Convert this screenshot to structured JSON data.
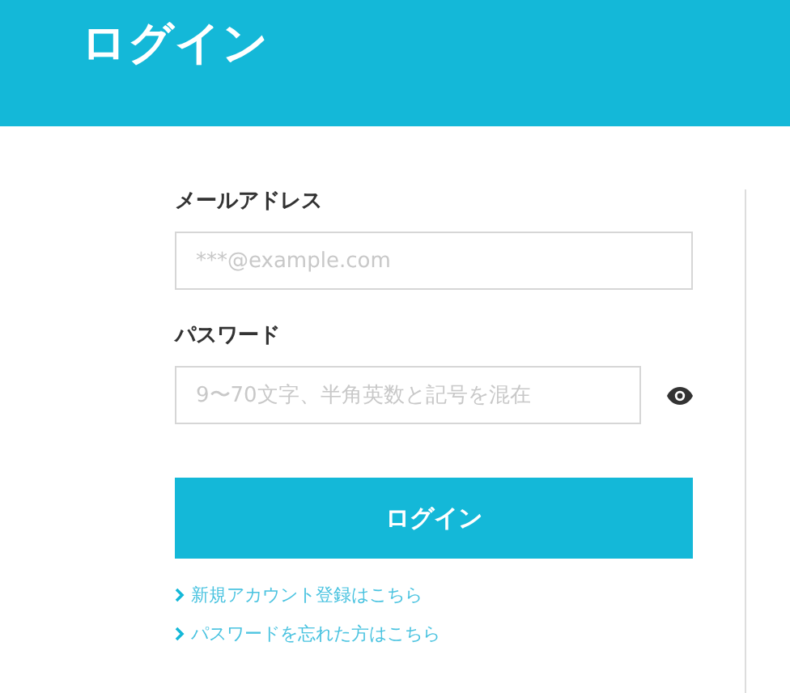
{
  "header": {
    "title": "ログイン"
  },
  "email": {
    "label": "メールアドレス",
    "placeholder": "***@example.com"
  },
  "password": {
    "label": "パスワード",
    "placeholder": "9〜70文字、半角英数と記号を混在"
  },
  "submit": {
    "label": "ログイン"
  },
  "links": [
    {
      "label": "新規アカウント登録はこちら"
    },
    {
      "label": "パスワードを忘れた方はこちら"
    }
  ]
}
